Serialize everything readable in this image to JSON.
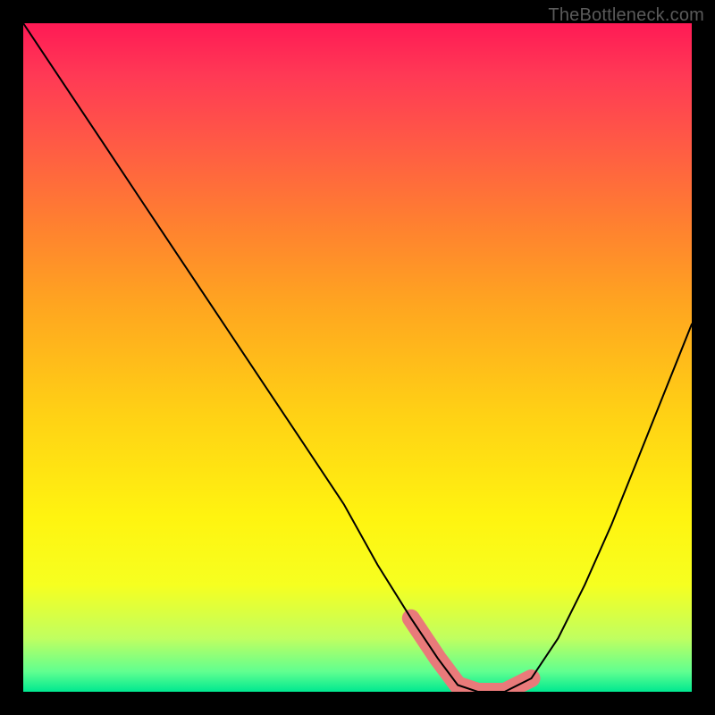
{
  "watermark": "TheBottleneck.com",
  "colors": {
    "frame": "#000000",
    "curve": "#000000",
    "basin_highlight": "#e97a7a"
  },
  "chart_data": {
    "type": "line",
    "title": "",
    "xlabel": "",
    "ylabel": "",
    "xlim": [
      0,
      100
    ],
    "ylim": [
      0,
      100
    ],
    "grid": false,
    "series": [
      {
        "name": "bottleneck-curve",
        "x": [
          0,
          6,
          12,
          18,
          24,
          30,
          36,
          42,
          48,
          53,
          58,
          62,
          65,
          68,
          72,
          76,
          80,
          84,
          88,
          92,
          96,
          100
        ],
        "values": [
          100,
          91,
          82,
          73,
          64,
          55,
          46,
          37,
          28,
          19,
          11,
          5,
          1,
          0,
          0,
          2,
          8,
          16,
          25,
          35,
          45,
          55
        ]
      }
    ],
    "annotations": [
      {
        "name": "basin-highlight",
        "type": "segment",
        "x": [
          58,
          62,
          65,
          68,
          72,
          76
        ],
        "y": [
          11,
          5,
          1,
          0,
          0,
          2
        ]
      }
    ]
  }
}
